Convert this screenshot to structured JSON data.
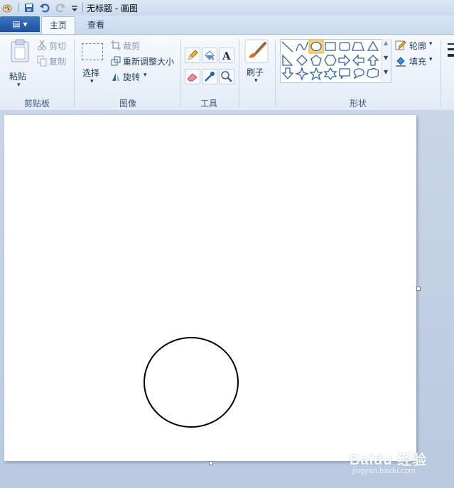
{
  "window": {
    "title": "无标题 - 画图"
  },
  "tabs": {
    "app_menu_label": "▤ ▾",
    "home": "主页",
    "view": "查看"
  },
  "ribbon": {
    "clipboard": {
      "paste": "粘贴",
      "cut": "剪切",
      "copy": "复制",
      "group": "剪贴板"
    },
    "image": {
      "select": "选择",
      "crop": "裁剪",
      "resize": "重新调整大小",
      "rotate": "旋转",
      "group": "图像"
    },
    "tools": {
      "group": "工具"
    },
    "brushes": {
      "label": "刷子"
    },
    "shapes": {
      "group": "形状",
      "outline": "轮廓",
      "fill": "填充"
    }
  },
  "watermark": {
    "brand": "Baidu 经验",
    "url": "jingyan.baidu.com"
  },
  "colors": {
    "accent": "#1d4f9e",
    "selected_shape": "#fbd47a"
  }
}
